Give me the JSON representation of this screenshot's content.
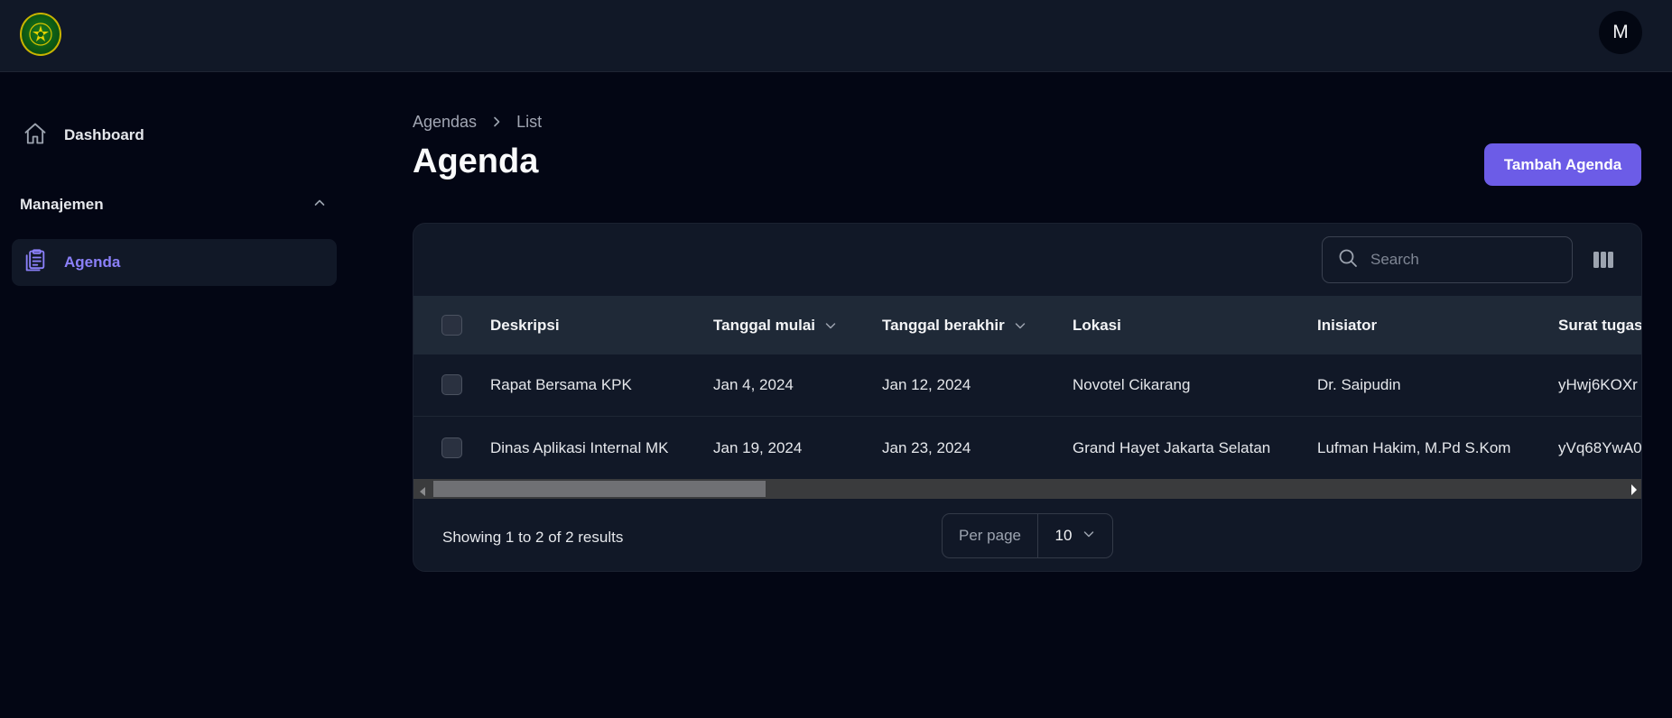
{
  "topbar": {
    "logo_icon": "court-emblem-icon",
    "avatar_initial": "M"
  },
  "sidebar": {
    "dashboard_label": "Dashboard",
    "group_label": "Manajemen",
    "items": [
      {
        "label": "Agenda",
        "icon": "clipboard-list-icon",
        "active": true
      }
    ]
  },
  "header": {
    "breadcrumb": [
      "Agendas",
      "List"
    ],
    "title": "Agenda",
    "create_button": "Tambah Agenda"
  },
  "table": {
    "search_placeholder": "Search",
    "columns": [
      "Deskripsi",
      "Tanggal mulai",
      "Tanggal berakhir",
      "Lokasi",
      "Inisiator",
      "Surat tugas"
    ],
    "rows": [
      {
        "deskripsi": "Rapat Bersama KPK",
        "mulai": "Jan 4, 2024",
        "berakhir": "Jan 12, 2024",
        "lokasi": "Novotel Cikarang",
        "inisiator": "Dr. Saipudin",
        "surat": "yHwj6KOXr"
      },
      {
        "deskripsi": "Dinas Aplikasi Internal MK",
        "mulai": "Jan 19, 2024",
        "berakhir": "Jan 23, 2024",
        "lokasi": "Grand Hayet Jakarta Selatan",
        "inisiator": "Lufman Hakim, M.Pd S.Kom",
        "surat": "yVq68YwA0"
      }
    ],
    "showing_text": "Showing 1 to 2 of 2 results",
    "per_page_label": "Per page",
    "per_page_value": "10"
  },
  "colors": {
    "background": "#030614",
    "surface": "#111827",
    "header_row": "#1f2937",
    "accent": "#6c5ce7",
    "active_nav_text": "#8b80f9"
  }
}
